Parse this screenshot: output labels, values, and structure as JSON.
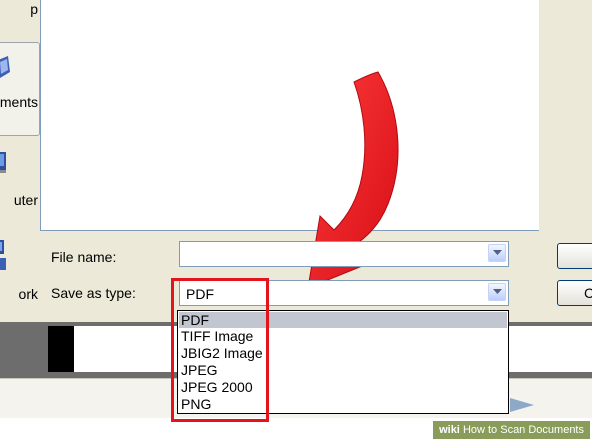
{
  "places_bar": {
    "items": [
      {
        "label": "p",
        "icon": "desktop-icon"
      },
      {
        "label": "ments",
        "icon": "my-documents-icon"
      },
      {
        "label": "uter",
        "icon": "my-computer-icon"
      },
      {
        "label": "ork",
        "icon": "network-icon"
      }
    ]
  },
  "form": {
    "file_name_label": "File name:",
    "file_name_value": "",
    "save_as_type_label": "Save as type:",
    "save_as_type_value": "PDF"
  },
  "dropdown": {
    "options": [
      "PDF",
      "TIFF Image",
      "JBIG2 Image",
      "JPEG",
      "JPEG 2000",
      "PNG"
    ],
    "selected_index": 0
  },
  "side_buttons": {
    "cancel_partial": "C"
  },
  "watermark": {
    "brand": "wiki",
    "text": "How to Scan Documents"
  },
  "colors": {
    "highlight": "#e3141b",
    "arrow": "#e8161e",
    "dialog_bg": "#ece9d8"
  }
}
